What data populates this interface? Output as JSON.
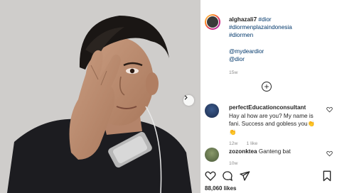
{
  "post": {
    "author": "alghazali7",
    "caption_tags": [
      "#dior",
      "#diormenplazaindonesia",
      "#diormen"
    ],
    "caption_mentions": [
      "@mydeardior",
      "@dior"
    ],
    "time": "15w"
  },
  "comments": [
    {
      "user": "perfectEducationconsultant",
      "text": "Hay al how are you? My name is fani. Success and gobless you👏👏",
      "time": "12w",
      "likes": "1 like"
    },
    {
      "user": "zozonktea",
      "text": "Ganteng bat",
      "time": "10w"
    }
  ],
  "likes_count": "88,060 likes",
  "colors": {
    "link": "#00376b",
    "meta": "#8e8e8e",
    "text": "#262626"
  },
  "icons": [
    "heart-icon",
    "comment-icon",
    "share-icon",
    "bookmark-icon",
    "plus-circle-icon",
    "chevron-right-icon"
  ]
}
